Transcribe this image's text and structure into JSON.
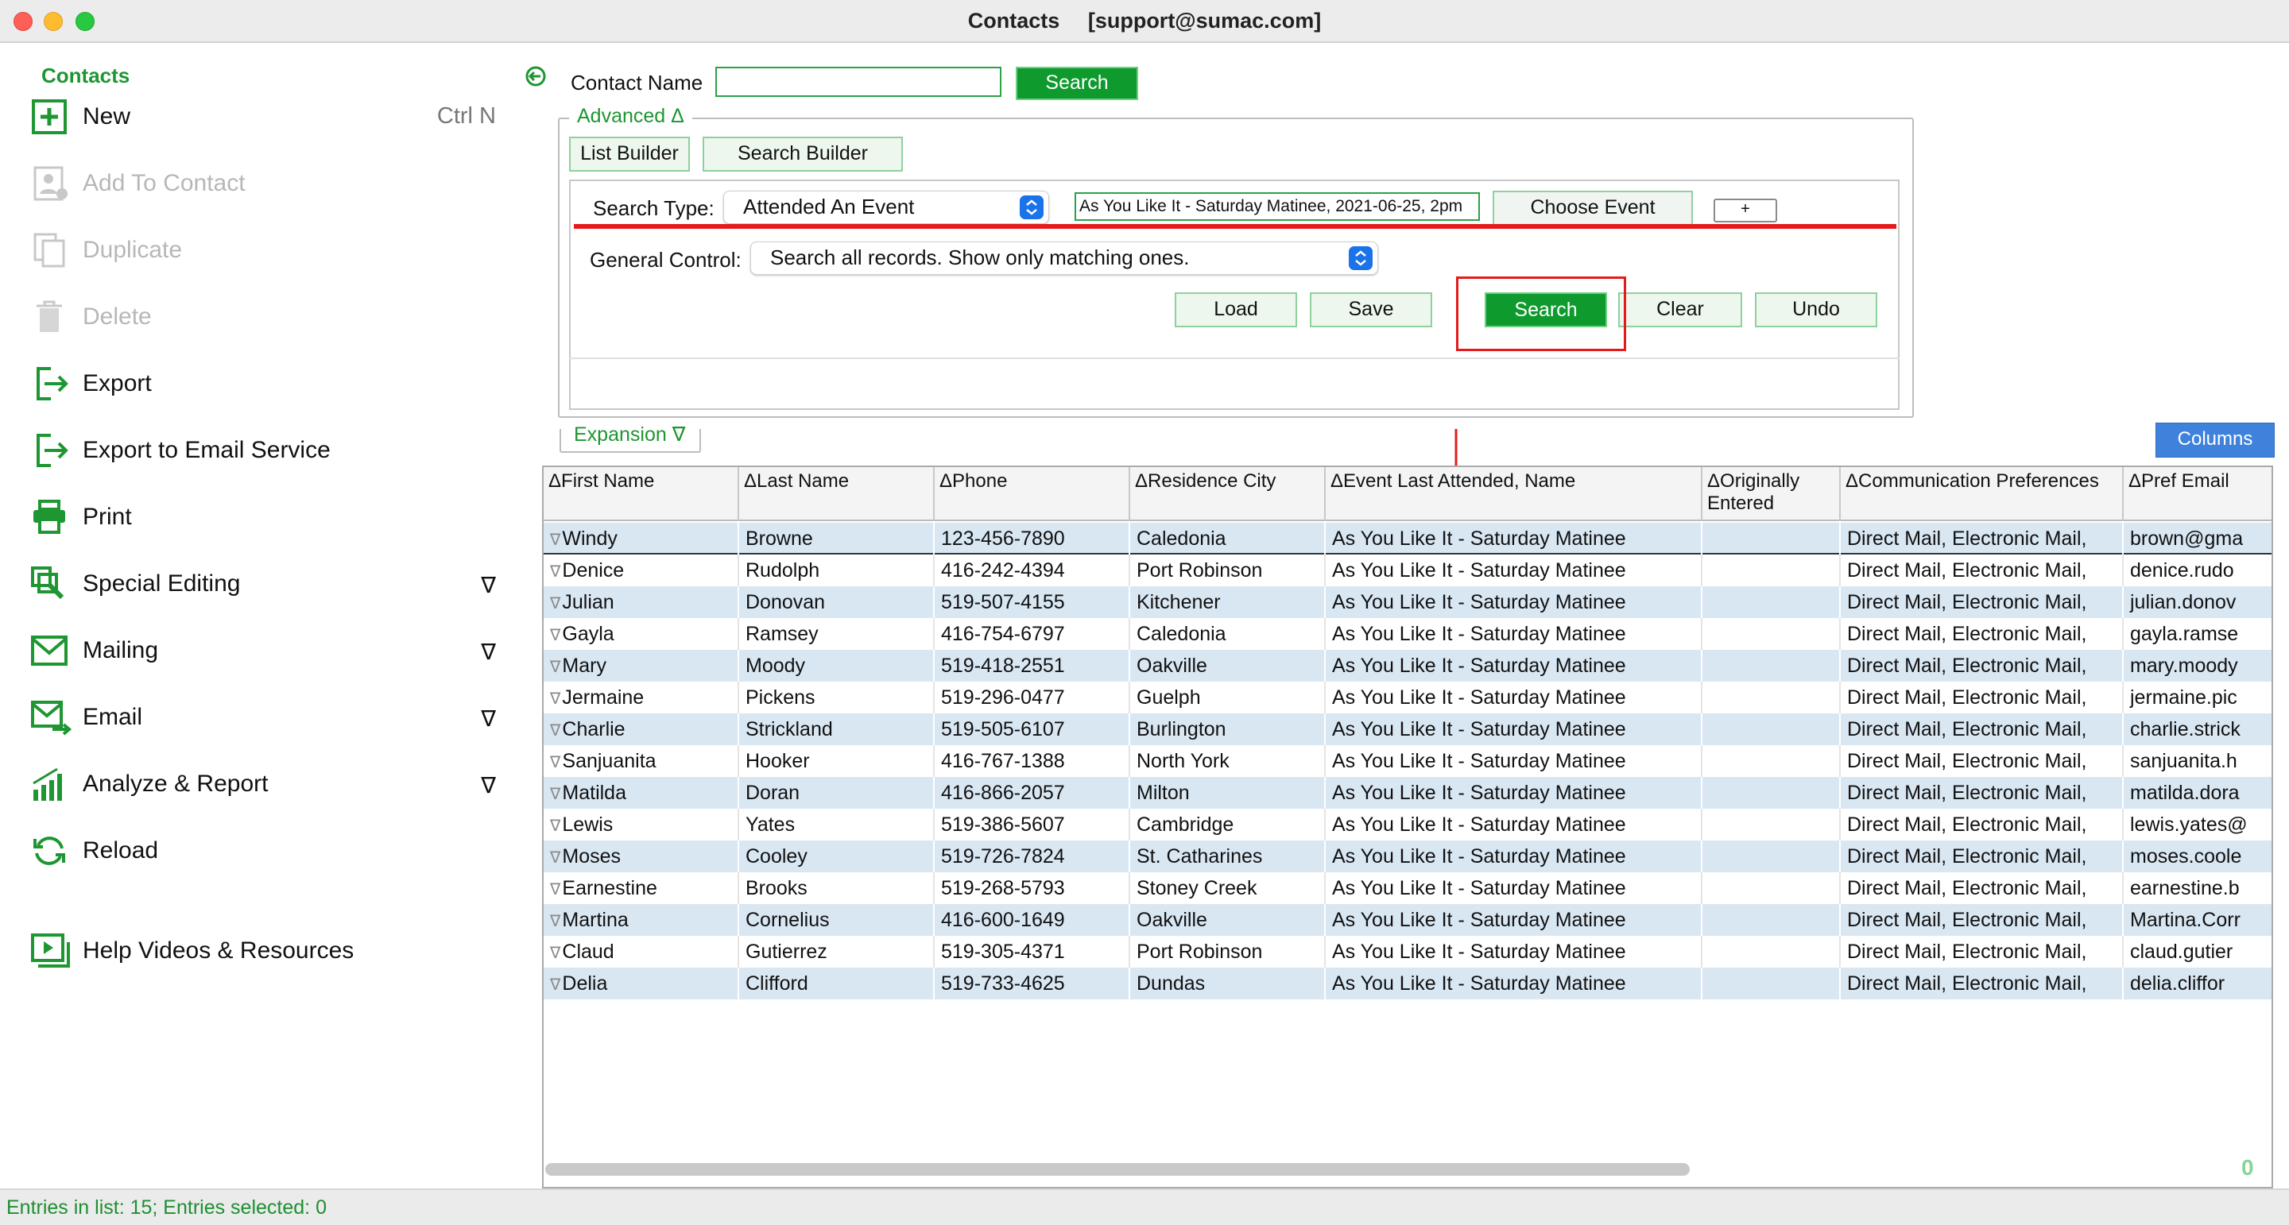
{
  "window": {
    "title": "Contacts",
    "account": "[support@sumac.com]"
  },
  "sidebar": {
    "header": "Contacts",
    "items": [
      {
        "label": "New",
        "shortcut": "Ctrl N",
        "icon": "plus-square-icon",
        "enabled": true
      },
      {
        "label": "Add To Contact",
        "icon": "add-to-contact-icon",
        "enabled": false
      },
      {
        "label": "Duplicate",
        "icon": "duplicate-icon",
        "enabled": false
      },
      {
        "label": "Delete",
        "icon": "trash-icon",
        "enabled": false
      },
      {
        "label": "Export",
        "icon": "export-icon",
        "enabled": true
      },
      {
        "label": "Export to Email Service",
        "icon": "export-icon",
        "enabled": true
      },
      {
        "label": "Print",
        "icon": "printer-icon",
        "enabled": true
      },
      {
        "label": "Special Editing",
        "icon": "special-editing-icon",
        "enabled": true,
        "dropdown": "∇"
      },
      {
        "label": "Mailing",
        "icon": "envelope-icon",
        "enabled": true,
        "dropdown": "∇"
      },
      {
        "label": "Email",
        "icon": "email-send-icon",
        "enabled": true,
        "dropdown": "∇"
      },
      {
        "label": "Analyze & Report",
        "icon": "bar-chart-icon",
        "enabled": true,
        "dropdown": "∇"
      },
      {
        "label": "Reload",
        "icon": "reload-icon",
        "enabled": true
      },
      {
        "label": "Help Videos & Resources",
        "icon": "video-icon",
        "enabled": true
      }
    ]
  },
  "search": {
    "contact_name_label": "Contact Name",
    "contact_name_value": "",
    "search_button": "Search"
  },
  "advanced": {
    "legend": "Advanced Δ",
    "list_builder": "List Builder",
    "search_builder": "Search Builder",
    "search_type_label": "Search Type:",
    "search_type_value": "Attended An Event",
    "event_value": "As You Like It - Saturday Matinee, 2021-06-25, 2pm",
    "choose_event": "Choose Event",
    "plus": "+",
    "general_control_label": "General Control:",
    "general_control_value": "Search all records. Show only matching ones.",
    "load": "Load",
    "save": "Save",
    "search": "Search",
    "clear": "Clear",
    "undo": "Undo"
  },
  "expansion": {
    "legend": "Expansion ∇"
  },
  "table": {
    "columns_button": "Columns",
    "headers": [
      "ΔFirst Name",
      "ΔLast Name",
      "ΔPhone",
      "ΔResidence City",
      "ΔEvent Last Attended, Name",
      "ΔOriginally Entered",
      "ΔCommunication Preferences",
      "ΔPref Email"
    ],
    "rows": [
      [
        "Windy",
        "Browne",
        "123-456-7890",
        "Caledonia",
        "As You Like It - Saturday Matinee",
        "",
        "Direct Mail, Electronic Mail,",
        "brown@gma"
      ],
      [
        "Denice",
        "Rudolph",
        "416-242-4394",
        "Port Robinson",
        "As You Like It - Saturday Matinee",
        "",
        "Direct Mail, Electronic Mail,",
        "denice.rudo"
      ],
      [
        "Julian",
        "Donovan",
        "519-507-4155",
        "Kitchener",
        "As You Like It - Saturday Matinee",
        "",
        "Direct Mail, Electronic Mail,",
        "julian.donov"
      ],
      [
        "Gayla",
        "Ramsey",
        "416-754-6797",
        "Caledonia",
        "As You Like It - Saturday Matinee",
        "",
        "Direct Mail, Electronic Mail,",
        "gayla.ramse"
      ],
      [
        "Mary",
        "Moody",
        "519-418-2551",
        "Oakville",
        "As You Like It - Saturday Matinee",
        "",
        "Direct Mail, Electronic Mail,",
        "mary.moody"
      ],
      [
        "Jermaine",
        "Pickens",
        "519-296-0477",
        "Guelph",
        "As You Like It - Saturday Matinee",
        "",
        "Direct Mail, Electronic Mail,",
        "jermaine.pic"
      ],
      [
        "Charlie",
        "Strickland",
        "519-505-6107",
        "Burlington",
        "As You Like It - Saturday Matinee",
        "",
        "Direct Mail, Electronic Mail,",
        "charlie.strick"
      ],
      [
        "Sanjuanita",
        "Hooker",
        "416-767-1388",
        "North York",
        "As You Like It - Saturday Matinee",
        "",
        "Direct Mail, Electronic Mail,",
        "sanjuanita.h"
      ],
      [
        "Matilda",
        "Doran",
        "416-866-2057",
        "Milton",
        "As You Like It - Saturday Matinee",
        "",
        "Direct Mail, Electronic Mail,",
        "matilda.dora"
      ],
      [
        "Lewis",
        "Yates",
        "519-386-5607",
        "Cambridge",
        "As You Like It - Saturday Matinee",
        "",
        "Direct Mail, Electronic Mail,",
        "lewis.yates@"
      ],
      [
        "Moses",
        "Cooley",
        "519-726-7824",
        "St. Catharines",
        "As You Like It - Saturday Matinee",
        "",
        "Direct Mail, Electronic Mail,",
        "moses.coole"
      ],
      [
        "Earnestine",
        "Brooks",
        "519-268-5793",
        "Stoney Creek",
        "As You Like It - Saturday Matinee",
        "",
        "Direct Mail, Electronic Mail,",
        "earnestine.b"
      ],
      [
        "Martina",
        "Cornelius",
        "416-600-1649",
        "Oakville",
        "As You Like It - Saturday Matinee",
        "",
        "Direct Mail, Electronic Mail,",
        "Martina.Corr"
      ],
      [
        "Claud",
        "Gutierrez",
        "519-305-4371",
        "Port Robinson",
        "As You Like It - Saturday Matinee",
        "",
        "Direct Mail, Electronic Mail,",
        "claud.gutier"
      ],
      [
        "Delia",
        "Clifford",
        "519-733-4625",
        "Dundas",
        "As You Like It - Saturday Matinee",
        "",
        "Direct Mail, Electronic Mail,",
        "delia.cliffor"
      ]
    ],
    "corner_value": "0"
  },
  "status": "Entries in list: 15; Entries selected: 0",
  "colors": {
    "accent_green": "#0f9a2e",
    "annotation_red": "#e41b1b",
    "row_alt": "#d9e7f3",
    "columns_blue": "#3f82dc"
  }
}
